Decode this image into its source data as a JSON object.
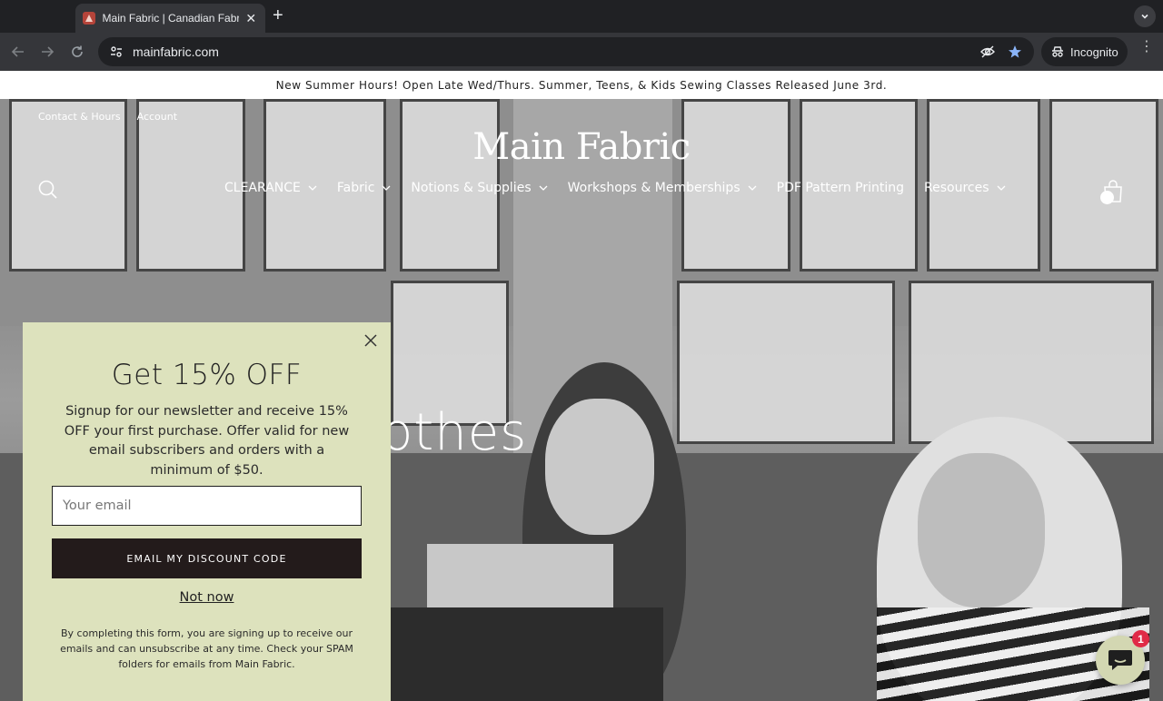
{
  "browser": {
    "tab_title": "Main Fabric | Canadian Fabric",
    "url": "mainfabric.com",
    "incognito_label": "Incognito"
  },
  "announcement": "New Summer Hours! Open Late Wed/Thurs. Summer, Teens, & Kids Sewing Classes Released June 3rd.",
  "header": {
    "top_links": [
      "Contact & Hours",
      "Account"
    ],
    "logo": "Main Fabric",
    "nav": [
      {
        "label": "CLEARANCE",
        "dropdown": true
      },
      {
        "label": "Fabric",
        "dropdown": true
      },
      {
        "label": "Notions & Supplies",
        "dropdown": true
      },
      {
        "label": "Workshops & Memberships",
        "dropdown": true
      },
      {
        "label": "PDF Pattern Printing",
        "dropdown": false
      },
      {
        "label": "Resources",
        "dropdown": true
      }
    ]
  },
  "hero": {
    "visible_text": "othes"
  },
  "popup": {
    "title": "Get 15% OFF",
    "description": "Signup for our newsletter and receive 15% OFF your first purchase. Offer valid for new email subscribers and orders with a minimum of $50.",
    "email_placeholder": "Your email",
    "submit_label": "EMAIL MY DISCOUNT CODE",
    "dismiss_label": "Not now",
    "fine_print": "By completing this form, you are signing up to receive our emails and can unsubscribe at any time. Check your SPAM folders for emails from Main Fabric."
  },
  "chat": {
    "badge_count": "1"
  },
  "colors": {
    "popup_bg": "#dde2bd",
    "button_bg": "#231b1b",
    "chat_badge": "#e02a47"
  }
}
